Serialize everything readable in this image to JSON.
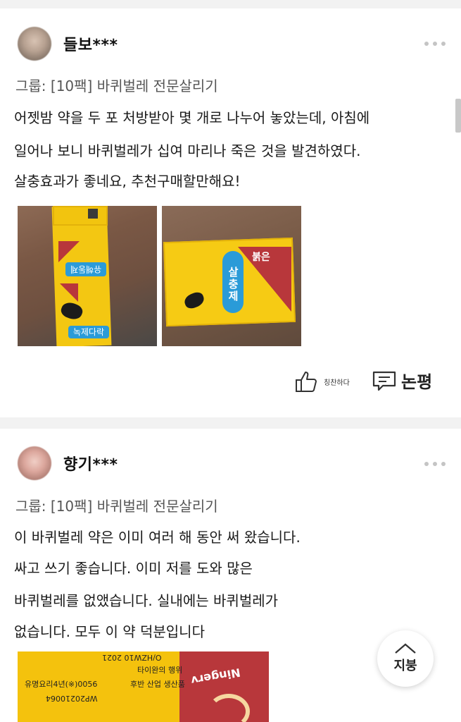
{
  "reviews": [
    {
      "username": "들보***",
      "group": "그룹: [10팩] 바퀴벌레 전문살리기",
      "lines": [
        "어젯밤 약을 두 포 처방받아 몇 개로 나누어 놓았는데, 아침에",
        "일어나 보니 바퀴벌레가 십여 마리나 죽은 것을 발견하였다.",
        "살충효과가 좋네요, 추천구매할만해요!"
      ],
      "photo1": {
        "label": "녹제다락",
        "label_top": "유해동제"
      },
      "photo2": {
        "label": "살충제",
        "corner": "붉은"
      },
      "like_label": "칭찬하다",
      "comment_label": "논평"
    },
    {
      "username": "향기***",
      "group": "그룹: [10팩] 바퀴벌레 전문살리기",
      "lines": [
        "이 바퀴벌레 약은 이미 여러 해 동안 써 왔습니다.",
        "싸고 쓰기 좋습니다. 이미 저를 도와 많은",
        "바퀴벌레를 없앴습니다. 실내에는 바퀴벌레가",
        "없습니다. 모두 이 약 덕분입니다"
      ],
      "photo": {
        "line1": "O/HZW10 2021",
        "line2": "타이완의 행위",
        "line3": "유명요리4년(※)0056",
        "line4": "후반 산업 생산품",
        "line5": "WP20210064",
        "brand": "Ningerv"
      }
    }
  ],
  "top_button_label": "지붕"
}
